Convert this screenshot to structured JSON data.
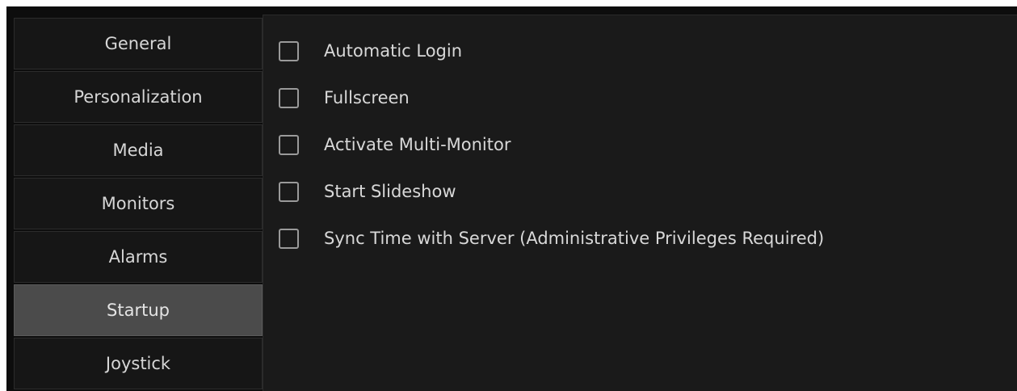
{
  "sidebar": {
    "items": [
      {
        "label": "General"
      },
      {
        "label": "Personalization"
      },
      {
        "label": "Media"
      },
      {
        "label": "Monitors"
      },
      {
        "label": "Alarms"
      },
      {
        "label": "Startup",
        "active": true
      },
      {
        "label": "Joystick"
      }
    ]
  },
  "startup": {
    "options": [
      {
        "label": "Automatic Login",
        "checked": false
      },
      {
        "label": "Fullscreen",
        "checked": false
      },
      {
        "label": "Activate Multi-Monitor",
        "checked": false
      },
      {
        "label": "Start Slideshow",
        "checked": false
      },
      {
        "label": "Sync Time with Server (Administrative Privileges Required)",
        "checked": false
      }
    ]
  },
  "colors": {
    "background": "#0d0d0d",
    "panel": "#1a1a1a",
    "nav_item": "#161616",
    "nav_active": "#4b4b4b",
    "text": "#d6d6d6",
    "checkbox_border": "#9a9a9a"
  }
}
